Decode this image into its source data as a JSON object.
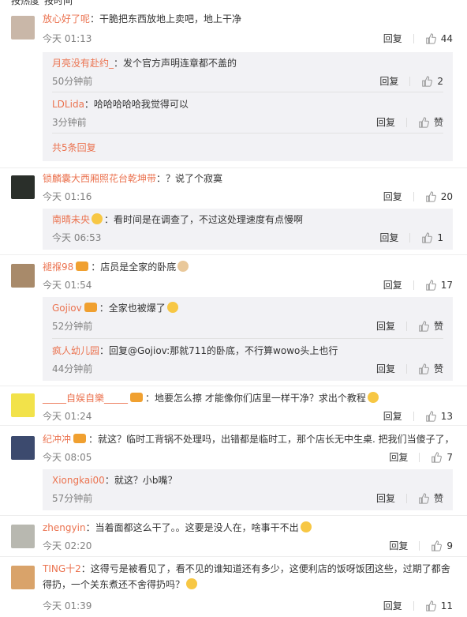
{
  "topbar": {
    "hot": "按热度",
    "time": "按时间"
  },
  "like_label": "赞",
  "reply_label": "回复",
  "comments": [
    {
      "user": "放心好了呢",
      "text": "：干脆把东西放地上卖吧，地上干净",
      "time": "今天 01:13",
      "likes": "44"
    },
    {
      "user": "锁麟囊大西厢照花台乾坤带",
      "text": "：？说了个寂寞",
      "time": "今天 01:16",
      "likes": "20"
    },
    {
      "user": "褪褓98",
      "text": "：店员是全家的卧底",
      "time": "今天 01:54",
      "likes": "17"
    },
    {
      "user": "_____自娱自樂_____",
      "text": "：地要怎么擦 才能像你们店里一样干净？求出个教程",
      "time": "今天 01:24",
      "likes": "13"
    },
    {
      "user": "纪冲冲",
      "text": "：就这？临时工背锅不处理吗，出错都是临时工，那个店长无中生桌. 把我们当傻子了，",
      "time": "今天 08:05",
      "likes": "7"
    },
    {
      "user": "zhengyin",
      "text": "：当着面都这么干了。。这要是没人在，啥事干不出",
      "time": "今天 02:20",
      "likes": "9"
    },
    {
      "user": "TING十2",
      "text": "：这得亏是被看见了，看不见的谁知道还有多少，这便利店的饭呀饭团这些，过期了都舍",
      "text2": "得扔，一个关东煮还不舍得扔吗？",
      "time": "今天 01:39",
      "likes": "11"
    }
  ],
  "replies": {
    "c1": [
      {
        "user": "月亮没有赴约_",
        "text": "：发个官方声明连章都不盖的",
        "time": "50分钟前",
        "likes": "2"
      },
      {
        "user": "LDLida",
        "text": "：哈哈哈哈哈我觉得可以",
        "time": "3分钟前",
        "likes": "赞"
      }
    ],
    "c1_more": "共5条回复",
    "c2": [
      {
        "user": "南晴未央",
        "text": "：看时间是在调查了，不过这处理速度有点慢啊",
        "time": "今天 06:53",
        "likes": "1"
      }
    ],
    "c3": [
      {
        "user": "Gojiov",
        "text": "：全家也被爆了",
        "time": "52分钟前",
        "likes": "赞"
      },
      {
        "user": "疯人幼儿园",
        "text": "：回复@Gojiov:那就711的卧底，不行算wowo头上也行",
        "time": "44分钟前",
        "likes": "赞"
      }
    ],
    "c5": [
      {
        "user": "Xiongkai00",
        "text": "：就这？小b嘴？",
        "time": "57分钟前",
        "likes": "赞"
      }
    ]
  },
  "colors": {
    "username": "#eb7350",
    "meta": "#808080",
    "subbg": "#f2f2f5"
  },
  "icons": {
    "like": "thumbs-up-icon"
  }
}
